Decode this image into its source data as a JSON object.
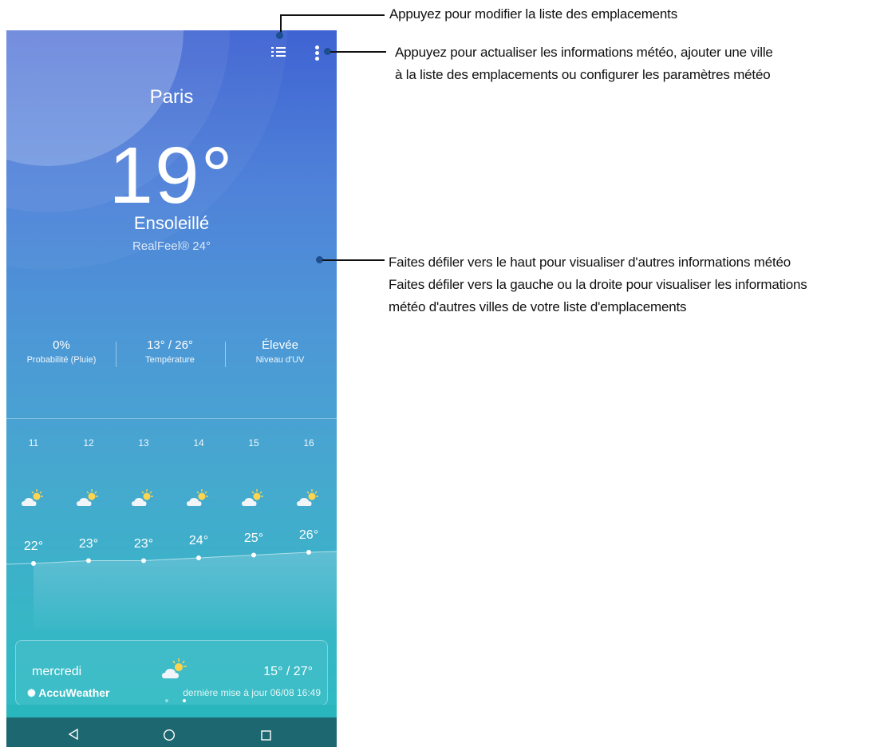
{
  "weather": {
    "city": "Paris",
    "temperature": "19°",
    "condition": "Ensoleillé",
    "realfeel": "RealFeel® 24°",
    "stats": [
      {
        "value": "0%",
        "caption": "Probabilité (Pluie)"
      },
      {
        "value": "13° / 26°",
        "caption": "Température"
      },
      {
        "value": "Élevée",
        "caption": "Niveau d'UV"
      }
    ],
    "hourly": [
      {
        "label": "11",
        "temp": "22°",
        "icon": "partly-sunny-icon"
      },
      {
        "label": "12",
        "temp": "23°",
        "icon": "partly-sunny-icon"
      },
      {
        "label": "13",
        "temp": "23°",
        "icon": "partly-sunny-icon"
      },
      {
        "label": "14",
        "temp": "24°",
        "icon": "partly-sunny-icon"
      },
      {
        "label": "15",
        "temp": "25°",
        "icon": "partly-sunny-icon"
      },
      {
        "label": "16",
        "temp": "26°",
        "icon": "partly-sunny-icon"
      }
    ],
    "daily": {
      "day": "mercredi",
      "range": "15° / 27°",
      "icon": "partly-sunny-icon"
    },
    "brand": "AccuWeather",
    "last_update": "dernière mise à jour 06/08 16:49",
    "pager": {
      "count": 2,
      "active": 2
    }
  },
  "annotations": {
    "top_menu": "Appuyez pour modifier la liste des emplacements",
    "more": [
      "Appuyez pour actualiser les informations météo, ajouter une ville",
      "à la liste des emplacements ou configurer les paramètres météo"
    ],
    "scroll": [
      "Faites défiler vers le haut pour visualiser d'autres informations météo",
      "Faites défiler vers la gauche ou la droite pour visualiser les informations",
      "météo d'autres villes de votre liste d'emplacements"
    ]
  },
  "colors": {
    "gradient_top": "#3f63d2",
    "gradient_bottom": "#2bbcc2",
    "navbar": "#1d6870",
    "callout_dot": "#1d4f8f"
  }
}
